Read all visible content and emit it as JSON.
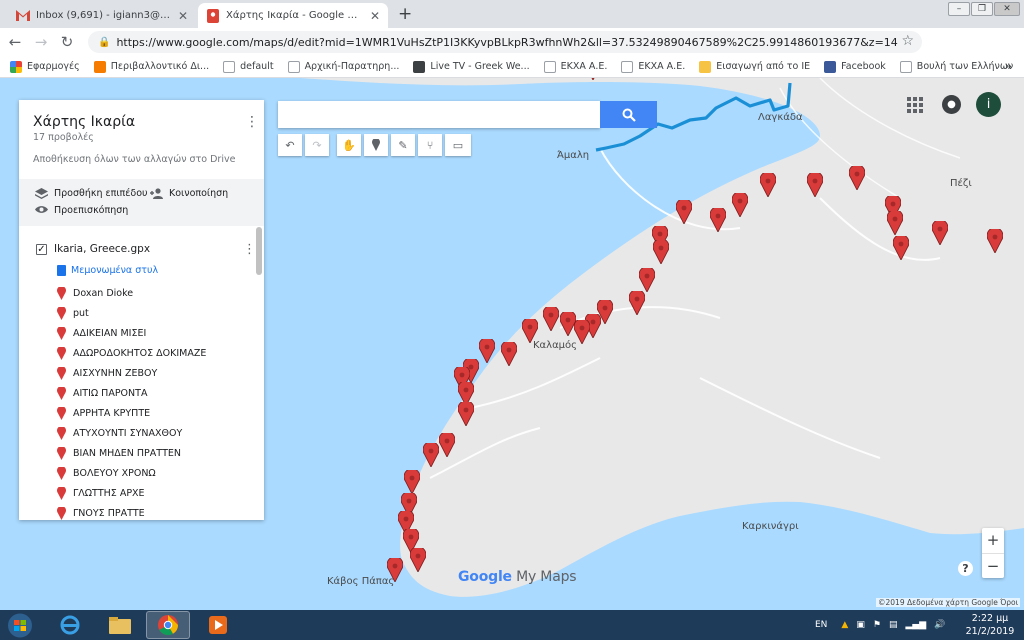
{
  "browser": {
    "tabs": [
      {
        "title": "Inbox (9,691) - igiann3@gmail.co",
        "icon": "gmail-icon"
      },
      {
        "title": "Χάρτης Ικαρία - Google My Map",
        "icon": "my-maps-icon"
      }
    ],
    "new_tab": "+",
    "close_glyph": "✕",
    "url": "https://www.google.com/maps/d/edit?mid=1WMR1VuHsZtP1I3KKyvpBLkpR3wfhnWh2&ll=37.53249890467589%2C25.9914860193677&z=14",
    "bookmarks": [
      {
        "label": "Εφαρμογές",
        "color": "#4285f4"
      },
      {
        "label": "Περιβαλλοντικό Δι...",
        "color": "#f57c00"
      },
      {
        "label": "default",
        "color": "#ffffff"
      },
      {
        "label": "Αρχική-Παρατηρη...",
        "color": "#ffffff"
      },
      {
        "label": "Live TV - Greek We...",
        "color": "#3c4043"
      },
      {
        "label": "ΕΚΧΑ Α.Ε.",
        "color": "#ffffff"
      },
      {
        "label": "ΕΚΧΑ Α.Ε.",
        "color": "#ffffff"
      },
      {
        "label": "Εισαγωγή από το IE",
        "color": "#f6c344"
      },
      {
        "label": "Facebook",
        "color": "#3b5998"
      },
      {
        "label": "Βουλή των Ελλήνων",
        "color": "#ffffff"
      }
    ],
    "bookmarks_more": "»"
  },
  "panel": {
    "map_title": "Χάρτης Ικαρία",
    "views": "17 προβολές",
    "saved_status": "Αποθήκευση όλων των αλλαγών στο Drive",
    "add_layer": "Προσθήκη επιπέδου",
    "share": "Κοινοποίηση",
    "preview": "Προεπισκόπηση",
    "layer": {
      "name": "Ikaria, Greece.gpx",
      "checked": true,
      "style_label": "Μεμονωμένα στυλ",
      "features": [
        "Doxan Dioke",
        "put",
        "ΑΔΙΚΕΙΑΝ ΜΙΣΕΙ",
        "ΑΔΩΡΟΔΟΚΗΤΟΣ ΔΟΚΙΜΑΖΕ",
        "ΑΙΣΧΥΝΗΝ ΖΕΒΟΥ",
        "ΑΙΤΙΩ ΠΑΡΟΝΤΑ",
        "ΑΡΡΗΤΑ ΚΡΥΠΤΕ",
        "ΑΤΥΧΟΥΝΤΙ ΣΥΝΑΧΘΟΥ",
        "ΒΙΑΝ ΜΗΔΕΝ ΠΡΑΤΤΕΝ",
        "ΒΟΛΕΥΟΥ ΧΡΟΝΩ",
        "ΓΛΩΤΤΗΣ ΑΡΧΕ",
        "ΓΝΟΥΣ ΠΡΑΤΤΕ"
      ]
    }
  },
  "map": {
    "place_labels": [
      {
        "text": "Λαγκάδα",
        "id": "lagkada"
      },
      {
        "text": "Άμαλη",
        "id": "amali"
      },
      {
        "text": "Πέζι",
        "id": "pezi"
      },
      {
        "text": "Καλαμός",
        "id": "kalamos"
      },
      {
        "text": "Καρκινάγρι",
        "id": "karkinagri"
      },
      {
        "text": "Κάβος Πάπας",
        "id": "kavos-papas"
      }
    ],
    "logo_google": "Google",
    "logo_mymaps": " My Maps",
    "copyright": "©2019 Δεδομένα χάρτη Google   Όροι",
    "zoom_in": "+",
    "zoom_out": "−",
    "help": "?",
    "marker_color": "#d93a3a",
    "track_color": "#1a8fd6"
  },
  "taskbar": {
    "lang": "EN",
    "time": "2:22 μμ",
    "date": "21/2/2019"
  },
  "user_initial": "i"
}
